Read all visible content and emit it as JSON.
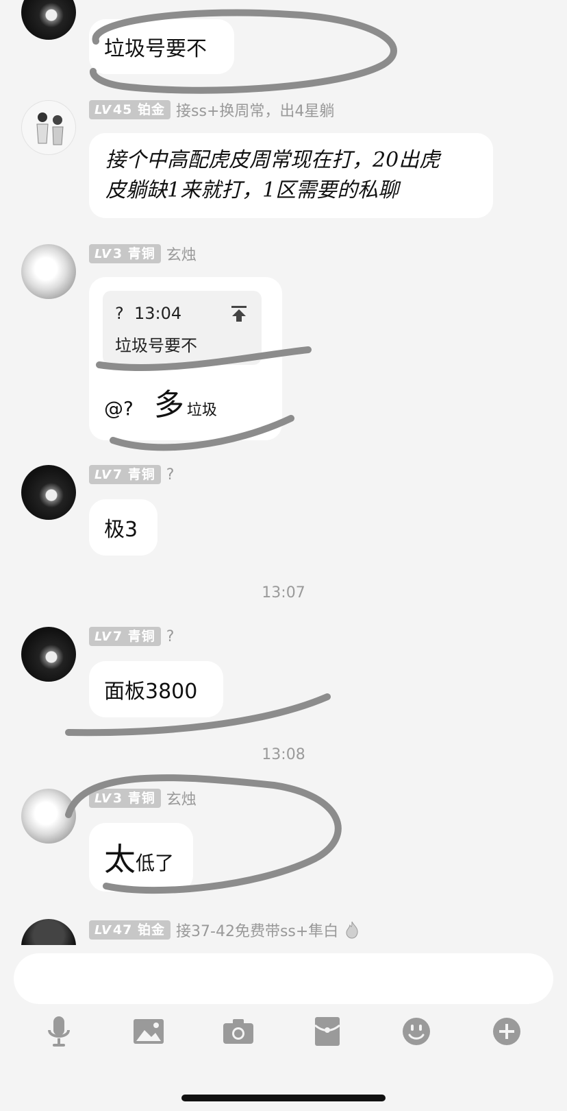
{
  "messages": [
    {
      "text": "垃圾号要不"
    },
    {
      "level": "45",
      "tier": "铂金",
      "nick": "接ss+换周常，出4星躺",
      "text_line1": "接个中高配虎皮周常现在打，20出虎",
      "text_line2": "皮躺缺1来就打，1区需要的私聊"
    },
    {
      "level": "3",
      "tier": "青铜",
      "nick": "玄烛",
      "quote_name": "?",
      "quote_time": "13:04",
      "quote_text": "垃圾号要不",
      "reply_at": "@?",
      "reply_big": "多",
      "reply_small": "垃圾"
    },
    {
      "level": "7",
      "tier": "青铜",
      "nick": "?",
      "text": "极3"
    },
    {
      "level": "7",
      "tier": "青铜",
      "nick": "?",
      "text": "面板3800"
    },
    {
      "level": "3",
      "tier": "青铜",
      "nick": "玄烛",
      "text_big": "太",
      "text_small": "低了"
    },
    {
      "level": "47",
      "tier": "铂金",
      "nick": "接37-42免费带ss+隼白"
    }
  ],
  "timestamps": [
    "13:07",
    "13:08"
  ],
  "level_prefix": "LV",
  "toolbar": {
    "icons": [
      "microphone-icon",
      "image-icon",
      "camera-icon",
      "red-packet-icon",
      "emoji-icon",
      "plus-icon"
    ]
  },
  "colors": {
    "background": "#f4f4f4",
    "bubble": "#ffffff",
    "level_badge": "#c7c7c7",
    "scribble": "#8c8c8c",
    "icon": "#9a9a9a"
  }
}
